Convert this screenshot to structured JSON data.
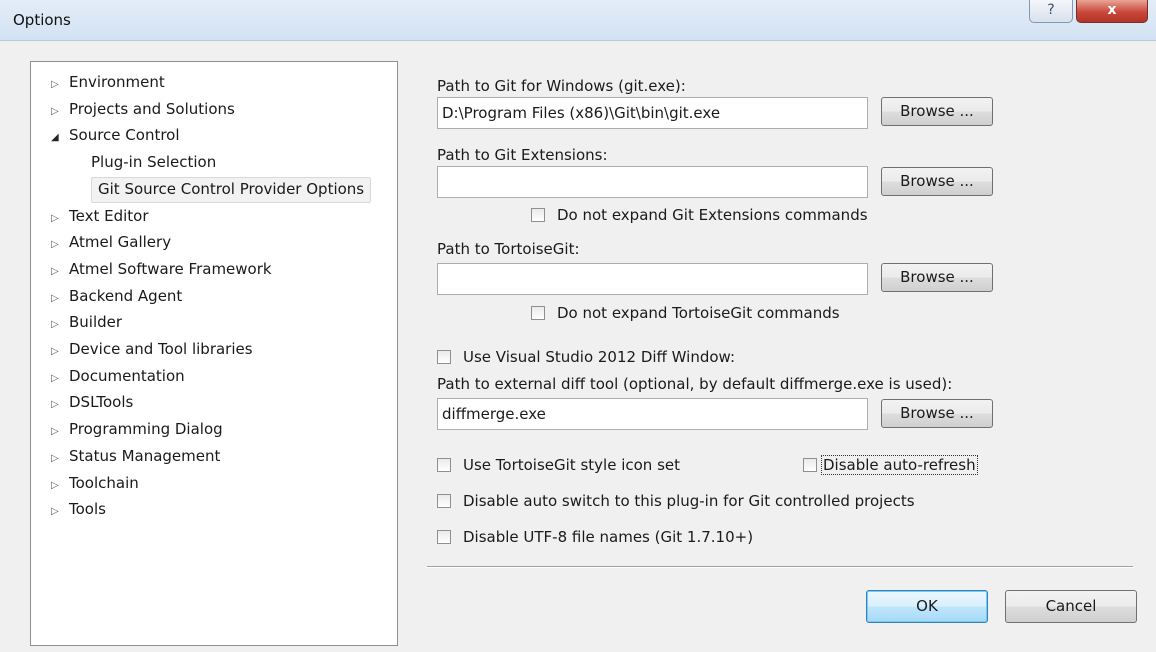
{
  "window": {
    "title": "Options",
    "help_glyph": "?",
    "close_glyph": "x"
  },
  "tree": {
    "items": [
      {
        "label": "Environment",
        "expanded": false
      },
      {
        "label": "Projects and Solutions",
        "expanded": false
      },
      {
        "label": "Source Control",
        "expanded": true
      },
      {
        "label": "Plug-in Selection",
        "child": true
      },
      {
        "label": "Git Source Control Provider Options",
        "child": true,
        "selected": true
      },
      {
        "label": "Text Editor",
        "expanded": false
      },
      {
        "label": "Atmel Gallery",
        "expanded": false
      },
      {
        "label": "Atmel Software Framework",
        "expanded": false
      },
      {
        "label": "Backend Agent",
        "expanded": false
      },
      {
        "label": "Builder",
        "expanded": false
      },
      {
        "label": "Device and Tool libraries",
        "expanded": false
      },
      {
        "label": "Documentation",
        "expanded": false
      },
      {
        "label": "DSLTools",
        "expanded": false
      },
      {
        "label": "Programming Dialog",
        "expanded": false
      },
      {
        "label": "Status Management",
        "expanded": false
      },
      {
        "label": "Toolchain",
        "expanded": false
      },
      {
        "label": "Tools",
        "expanded": false
      }
    ],
    "collapsed_glyph": "▷",
    "expanded_glyph": "◢"
  },
  "git_path": {
    "label": "Path to Git for Windows (git.exe):",
    "value": "D:\\Program Files (x86)\\Git\\bin\\git.exe",
    "browse": "Browse ..."
  },
  "git_extensions": {
    "label": "Path to Git Extensions:",
    "value": "",
    "browse": "Browse ...",
    "no_expand_label": "Do not expand Git Extensions commands",
    "no_expand_checked": false
  },
  "tortoise_git": {
    "label": "Path to TortoiseGit:",
    "value": "",
    "browse": "Browse ...",
    "no_expand_label": "Do not expand TortoiseGit commands",
    "no_expand_checked": false
  },
  "diff": {
    "use_vs2012_label": "Use Visual Studio 2012 Diff Window:",
    "use_vs2012_checked": false,
    "external_label": "Path to external diff tool (optional, by default diffmerge.exe is used):",
    "value": "diffmerge.exe",
    "browse": "Browse ..."
  },
  "options": {
    "tortoise_icons_label": "Use TortoiseGit style icon set",
    "tortoise_icons_checked": false,
    "disable_refresh_label": "Disable auto-refresh",
    "disable_refresh_checked": false,
    "disable_switch_label": "Disable auto switch to this plug-in for Git controlled projects",
    "disable_switch_checked": false,
    "disable_utf8_label": "Disable UTF-8 file names (Git 1.7.10+)",
    "disable_utf8_checked": false
  },
  "buttons": {
    "ok": "OK",
    "cancel": "Cancel"
  }
}
